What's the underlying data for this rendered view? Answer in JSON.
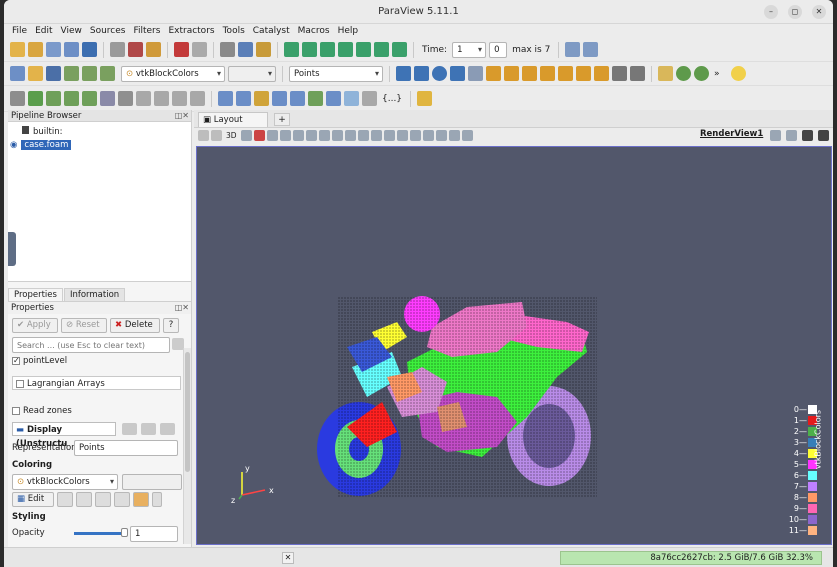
{
  "window": {
    "title": "ParaView 5.11.1"
  },
  "menu": [
    "File",
    "Edit",
    "View",
    "Sources",
    "Filters",
    "Extractors",
    "Tools",
    "Catalyst",
    "Macros",
    "Help"
  ],
  "toolbar": {
    "time_label": "Time:",
    "time_value": "1",
    "step_value": "0",
    "max_label": "max is 7",
    "color_by": "vtkBlockColors",
    "representation": "Points"
  },
  "pipeline": {
    "title": "Pipeline Browser",
    "items": [
      {
        "label": "builtin:"
      },
      {
        "label": "case.foam"
      }
    ]
  },
  "tabs": {
    "properties": "Properties",
    "information": "Information"
  },
  "properties": {
    "title": "Properties",
    "apply": "Apply",
    "reset": "Reset",
    "delete": "Delete",
    "help": "?",
    "search_placeholder": "Search ... (use Esc to clear text)",
    "point_level": "pointLevel",
    "lagrangian": "Lagrangian Arrays",
    "read_zones": "Read zones",
    "display": "Display (Unstructu",
    "representation_label": "Representation",
    "representation_value": "Points",
    "coloring": "Coloring",
    "coloring_value": "vtkBlockColors",
    "edit": "Edit",
    "styling": "Styling",
    "opacity": "Opacity",
    "opacity_value": "1"
  },
  "layout": {
    "tab": "Layout #1",
    "add": "+",
    "renderview": "RenderView1",
    "mode_3d": "3D"
  },
  "status": {
    "memory": "8a76cc2627cb: 2.5 GiB/7.6 GiB 32.3%",
    "memory_fraction": 0.323
  },
  "legend": {
    "title": "vtkBlockColors",
    "entries": [
      "0",
      "1",
      "2",
      "3",
      "4",
      "5",
      "6",
      "7",
      "8",
      "9",
      "10",
      "11"
    ],
    "colors": [
      "#ffffff",
      "#e41a1c",
      "#4daf4a",
      "#377eb8",
      "#ffff33",
      "#ff33ff",
      "#66ffff",
      "#bf80ff",
      "#ff9966",
      "#ff66b3",
      "#8c66cc",
      "#ffb380"
    ]
  },
  "axes": {
    "x": "x",
    "y": "y",
    "z": "z"
  }
}
